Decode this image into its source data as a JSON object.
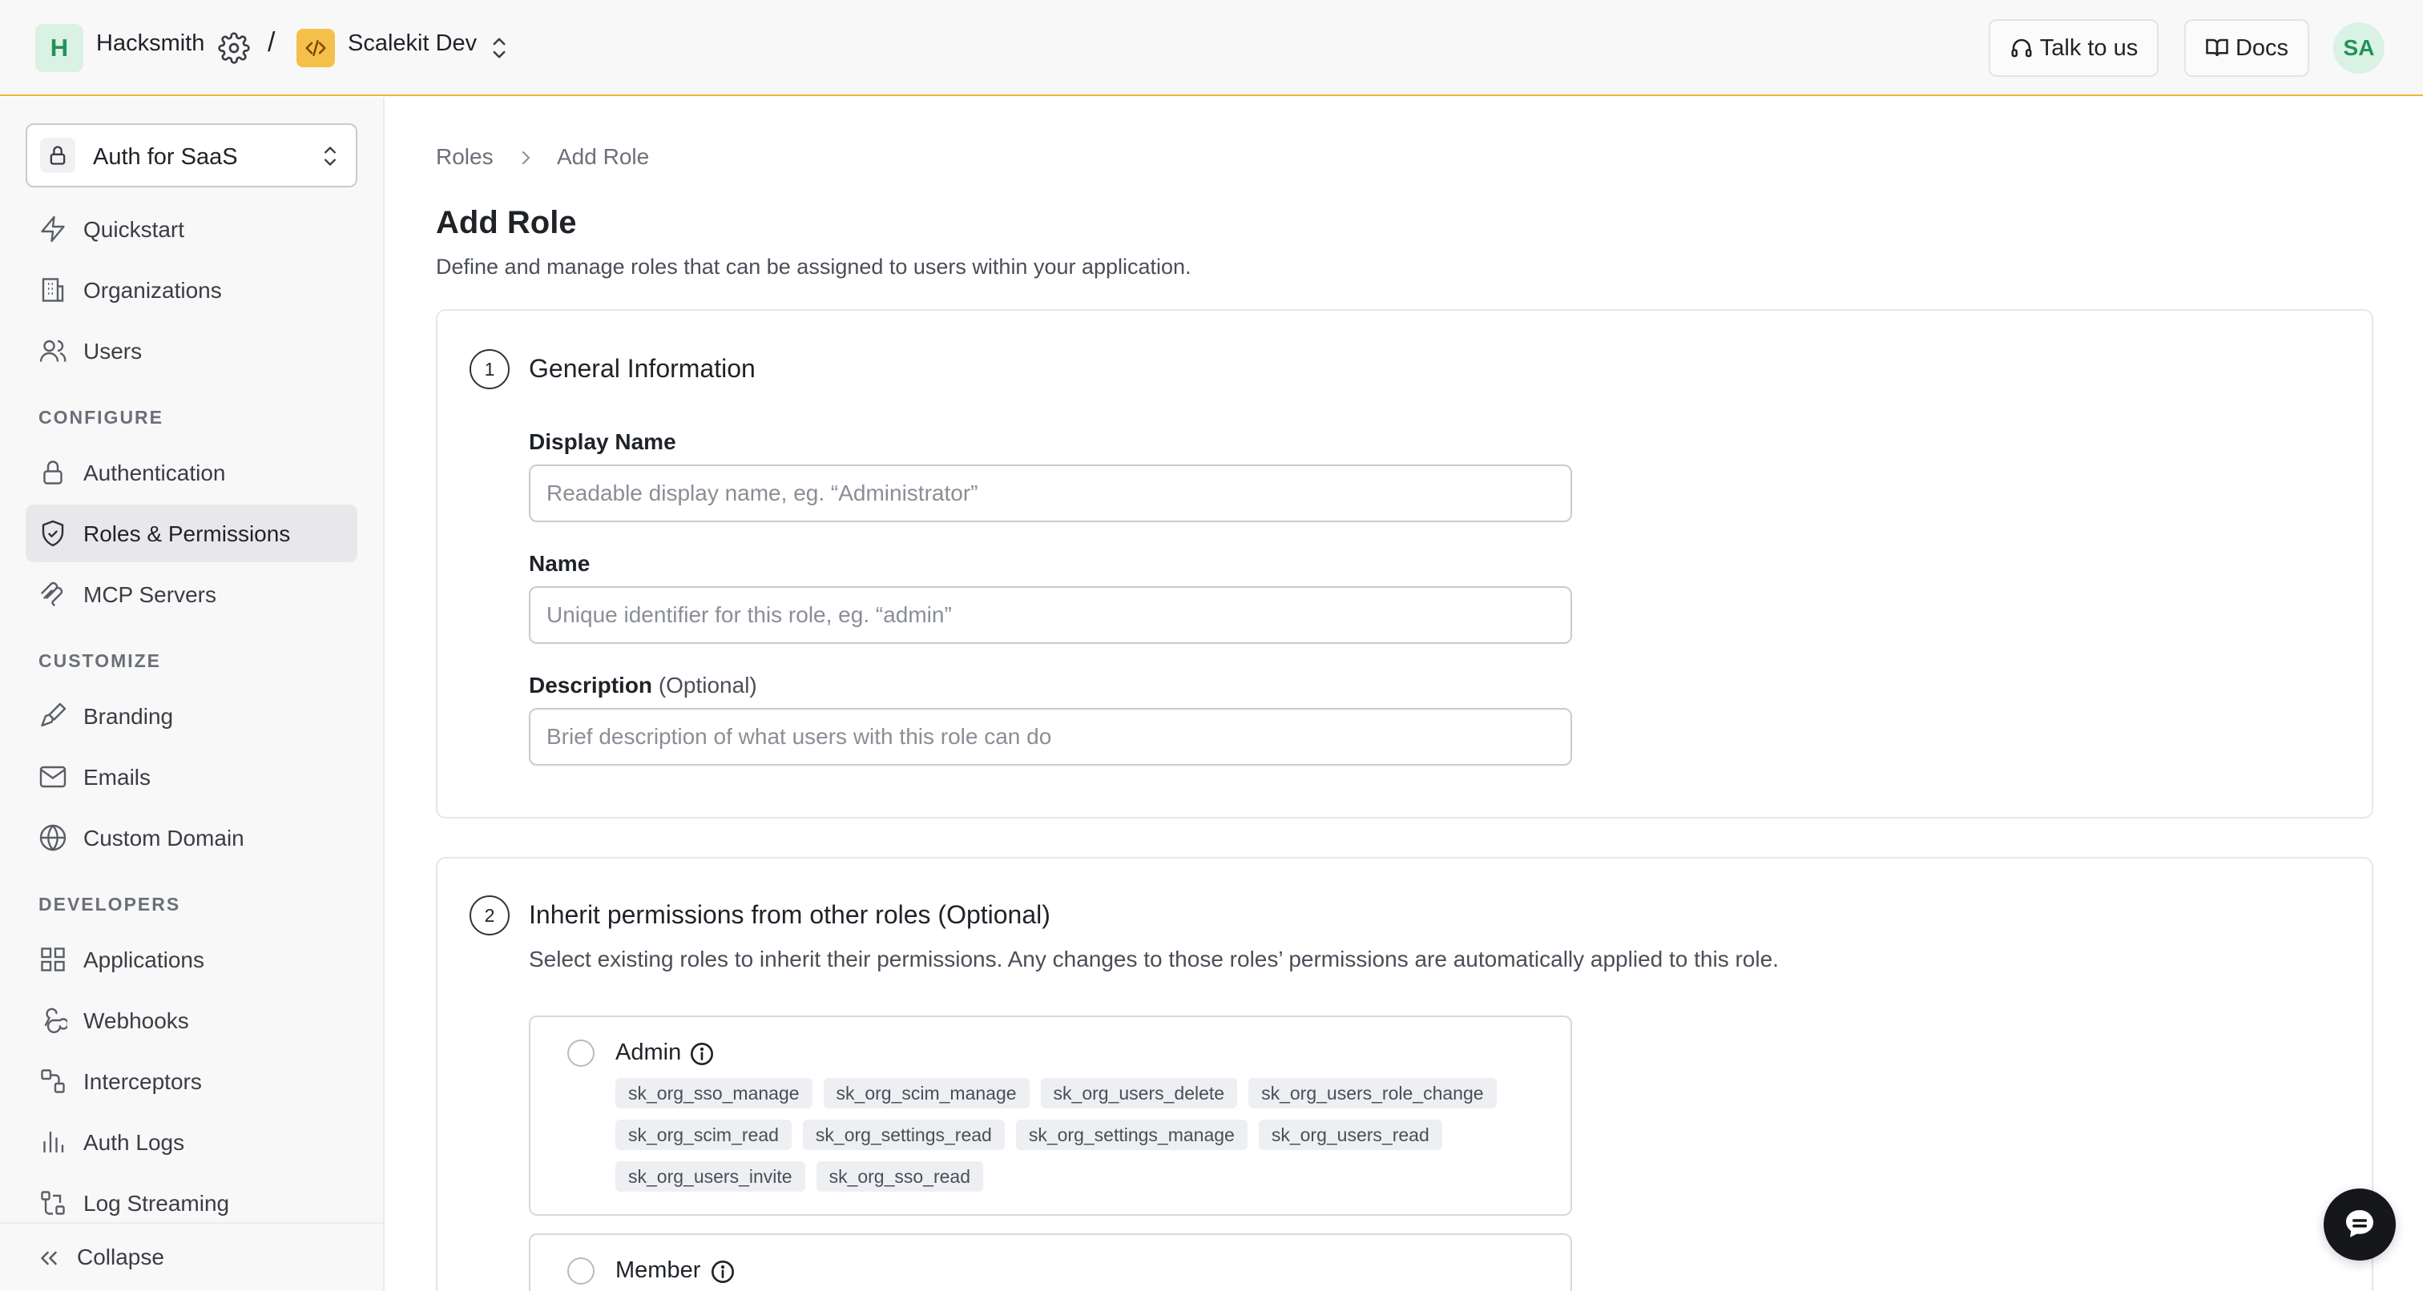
{
  "topbar": {
    "workspace_initial": "H",
    "workspace_name": "Hacksmith",
    "separator": "/",
    "environment_name": "Scalekit Dev",
    "talk_label": "Talk to us",
    "docs_label": "Docs",
    "user_initials": "SA"
  },
  "sidebar": {
    "product_label": "Auth for SaaS",
    "items_top": [
      {
        "label": "Quickstart",
        "icon": "lightning-icon"
      },
      {
        "label": "Organizations",
        "icon": "building-icon"
      },
      {
        "label": "Users",
        "icon": "users-icon"
      }
    ],
    "section_configure": "CONFIGURE",
    "items_configure": [
      {
        "label": "Authentication",
        "icon": "lock-icon"
      },
      {
        "label": "Roles & Permissions",
        "icon": "shield-check-icon",
        "active": true
      },
      {
        "label": "MCP Servers",
        "icon": "mcp-icon"
      }
    ],
    "section_customize": "CUSTOMIZE",
    "items_customize": [
      {
        "label": "Branding",
        "icon": "paintbrush-icon"
      },
      {
        "label": "Emails",
        "icon": "mail-icon"
      },
      {
        "label": "Custom Domain",
        "icon": "globe-icon"
      }
    ],
    "section_developers": "DEVELOPERS",
    "items_developers": [
      {
        "label": "Applications",
        "icon": "grid-icon"
      },
      {
        "label": "Webhooks",
        "icon": "webhook-icon"
      },
      {
        "label": "Interceptors",
        "icon": "interceptor-icon"
      },
      {
        "label": "Auth Logs",
        "icon": "bar-chart-icon"
      },
      {
        "label": "Log Streaming",
        "icon": "log-stream-icon"
      }
    ],
    "collapse_label": "Collapse"
  },
  "main": {
    "breadcrumb": [
      "Roles",
      "Add Role"
    ],
    "title": "Add Role",
    "subtitle": "Define and manage roles that can be assigned to users within your application.",
    "section1": {
      "step": "1",
      "title": "General Information",
      "display_name_label": "Display Name",
      "display_name_placeholder": "Readable display name, eg. “Administrator”",
      "display_name_value": "",
      "name_label": "Name",
      "name_placeholder": "Unique identifier for this role, eg. “admin”",
      "name_value": "",
      "description_label": "Description",
      "description_optional": "(Optional)",
      "description_placeholder": "Brief description of what users with this role can do",
      "description_value": ""
    },
    "section2": {
      "step": "2",
      "title": "Inherit permissions from other roles (Optional)",
      "subtitle": "Select existing roles to inherit their permissions. Any changes to those roles’ permissions are automatically applied to this role.",
      "roles": [
        {
          "name": "Admin",
          "permissions": [
            "sk_org_sso_manage",
            "sk_org_scim_manage",
            "sk_org_users_delete",
            "sk_org_users_role_change",
            "sk_org_scim_read",
            "sk_org_settings_read",
            "sk_org_settings_manage",
            "sk_org_users_read",
            "sk_org_users_invite",
            "sk_org_sso_read"
          ]
        },
        {
          "name": "Member",
          "permissions": []
        }
      ]
    }
  },
  "colors": {
    "accent_line": "#f0b43a",
    "avatar_green": "#23925a",
    "env_icon_bg": "#f5c04a",
    "chip_bg": "#eeeff2"
  }
}
